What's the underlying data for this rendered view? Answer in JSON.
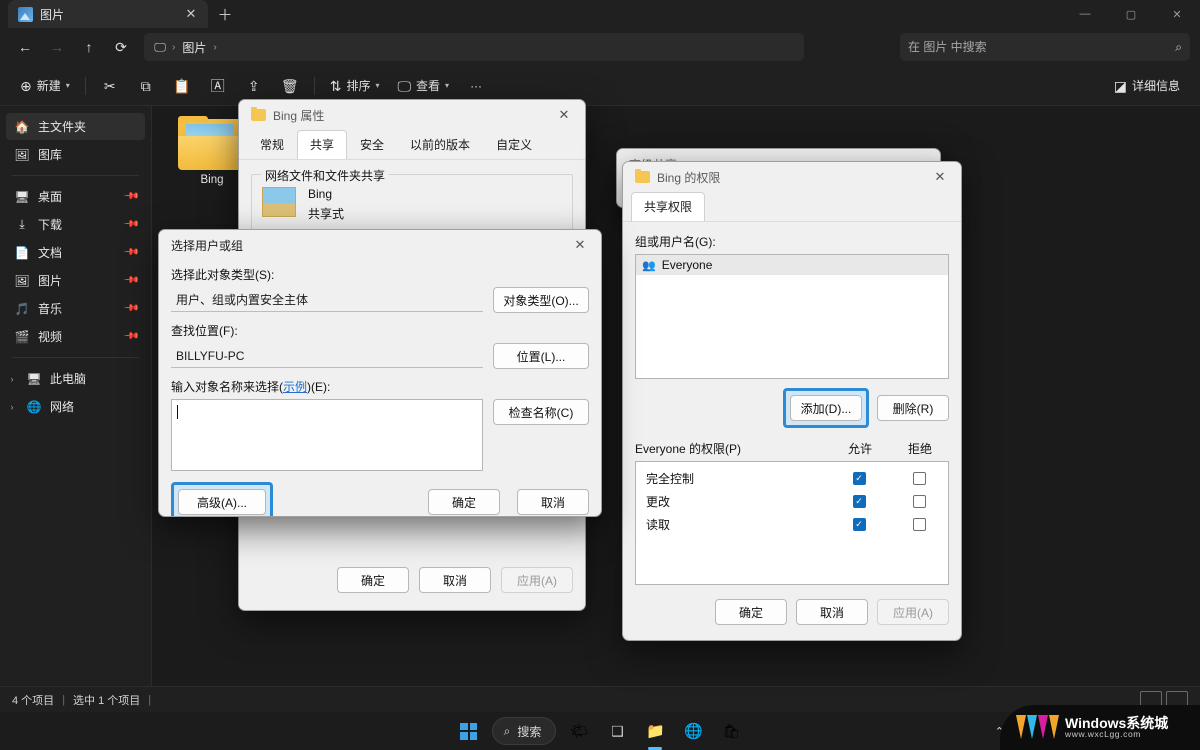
{
  "explorer": {
    "tab": {
      "title": "图片",
      "icon": "pictures-icon",
      "close_label": "✕",
      "new_tab_label": "＋"
    },
    "window_controls": {
      "minimize": "—",
      "maximize": "▢",
      "close": "✕"
    },
    "nav": {
      "back": "←",
      "forward": "→",
      "up": "↑",
      "refresh": "⟳",
      "breadcrumb_icon": "monitor-icon",
      "breadcrumb": [
        "图片"
      ],
      "sep": "›"
    },
    "search": {
      "placeholder": "在 图片 中搜索",
      "value": ""
    },
    "command_bar": {
      "new_label": "新建",
      "cut_label": "剪切",
      "copy_label": "复制",
      "paste_label": "粘贴",
      "rename_label": "重命名",
      "share_label": "共享",
      "delete_label": "删除",
      "sort_label": "排序",
      "view_label": "查看",
      "more_label": "···",
      "details_label": "详细信息"
    },
    "sidebar": {
      "items": [
        {
          "label": "主文件夹",
          "icon": "home-icon",
          "selected": true,
          "pinned": false
        },
        {
          "label": "图库",
          "icon": "gallery-icon",
          "selected": false,
          "pinned": false
        },
        {
          "label": "桌面",
          "icon": "desktop-icon",
          "selected": false,
          "pinned": true
        },
        {
          "label": "下载",
          "icon": "downloads-icon",
          "selected": false,
          "pinned": true
        },
        {
          "label": "文档",
          "icon": "documents-icon",
          "selected": false,
          "pinned": true
        },
        {
          "label": "图片",
          "icon": "pictures-icon",
          "selected": false,
          "pinned": true
        },
        {
          "label": "音乐",
          "icon": "music-icon",
          "selected": false,
          "pinned": true
        },
        {
          "label": "视频",
          "icon": "videos-icon",
          "selected": false,
          "pinned": true
        },
        {
          "label": "此电脑",
          "icon": "this-pc-icon",
          "selected": false,
          "expandable": true
        },
        {
          "label": "网络",
          "icon": "network-icon",
          "selected": false,
          "expandable": true
        }
      ]
    },
    "files": [
      {
        "name": "Bing",
        "type": "folder"
      }
    ],
    "status": {
      "count": "4 个项目",
      "selected": "选中 1 个项目"
    }
  },
  "properties_dialog": {
    "title": "Bing 属性",
    "close": "✕",
    "tabs": [
      {
        "label": "常规",
        "active": false
      },
      {
        "label": "共享",
        "active": true
      },
      {
        "label": "安全",
        "active": false
      },
      {
        "label": "以前的版本",
        "active": false
      },
      {
        "label": "自定义",
        "active": false
      }
    ],
    "group_title": "网络文件和文件夹共享",
    "share_name": "Bing",
    "share_state": "共享式",
    "buttons": {
      "ok": "确定",
      "cancel": "取消",
      "apply": "应用(A)"
    }
  },
  "advanced_share_window": {
    "title": "高级共享",
    "collapse": "⌄"
  },
  "permissions_dialog": {
    "title": "Bing 的权限",
    "close": "✕",
    "tab": "共享权限",
    "group_label": "组或用户名(G):",
    "users": [
      {
        "name": "Everyone",
        "selected": true
      }
    ],
    "add_button": "添加(D)...",
    "remove_button": "删除(R)",
    "perm_label": "Everyone 的权限(P)",
    "col_allow": "允许",
    "col_deny": "拒绝",
    "permissions": [
      {
        "name": "完全控制",
        "allow": true,
        "deny": false
      },
      {
        "name": "更改",
        "allow": true,
        "deny": false
      },
      {
        "name": "读取",
        "allow": true,
        "deny": false
      }
    ],
    "buttons": {
      "ok": "确定",
      "cancel": "取消",
      "apply": "应用(A)"
    }
  },
  "select_users_dialog": {
    "title": "选择用户或组",
    "close": "✕",
    "object_type_label": "选择此对象类型(S):",
    "object_type_value": "用户、组或内置安全主体",
    "object_type_button": "对象类型(O)...",
    "location_label": "查找位置(F):",
    "location_value": "BILLYFU-PC",
    "location_button": "位置(L)...",
    "names_label_pre": "输入对象名称来选择(",
    "names_label_link": "示例",
    "names_label_post": ")(E):",
    "names_value": "",
    "check_names_button": "检查名称(C)",
    "advanced_button": "高级(A)...",
    "ok_button": "确定",
    "cancel_button": "取消"
  },
  "taskbar": {
    "start_label": "开始",
    "search_placeholder": "搜索",
    "items": [
      {
        "name": "widgets-icon"
      },
      {
        "name": "task-view-icon"
      },
      {
        "name": "file-explorer-icon",
        "active": true
      },
      {
        "name": "edge-icon"
      },
      {
        "name": "store-icon"
      }
    ],
    "tray_chevron": "⌃"
  },
  "watermark": {
    "line1": "Windows系统城",
    "line2": "www.wxcLgg.com"
  },
  "colors": {
    "accent": "#2f8ad4",
    "highlight_fill": "#cfe7f7",
    "checkbox_checked": "#0f6cbd",
    "window_bg": "#202020",
    "dialog_bg": "#f0f0f0"
  }
}
